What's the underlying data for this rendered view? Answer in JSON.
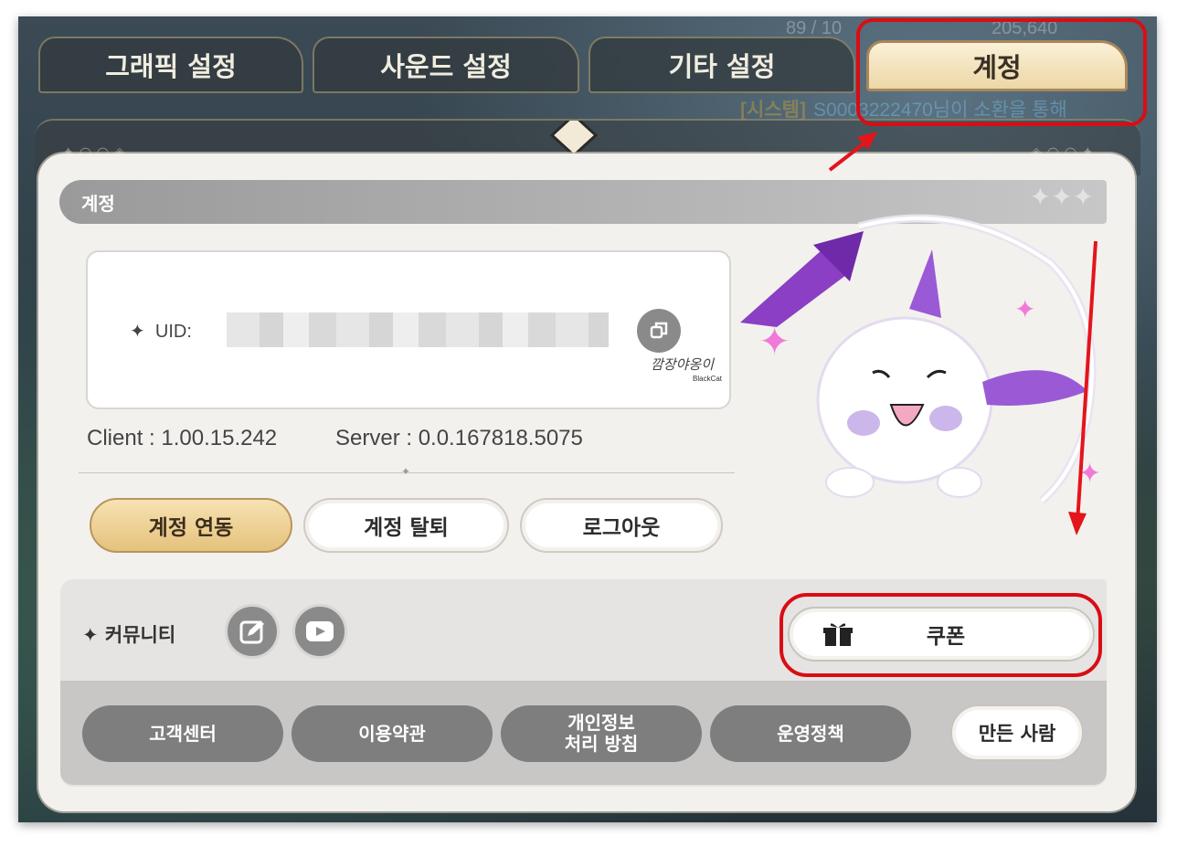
{
  "tabs": [
    {
      "label": "그래픽 설정",
      "active": false
    },
    {
      "label": "사운드 설정",
      "active": false
    },
    {
      "label": "기타 설정",
      "active": false
    },
    {
      "label": "계정",
      "active": true
    }
  ],
  "hud": {
    "keys": "89 / 10",
    "gold": "205,640",
    "system_tag": "[시스템]",
    "system_msg": "S0003222470님이 소환을 통해"
  },
  "section": {
    "title": "계정"
  },
  "uid": {
    "label": "UID:"
  },
  "watermark": {
    "text": "깜장야옹이",
    "sub": "BlackCat"
  },
  "version": {
    "client": "Client : 1.00.15.242",
    "server": "Server : 0.0.167818.5075"
  },
  "account_buttons": {
    "link": "계정 연동",
    "withdraw": "계정 탈퇴",
    "logout": "로그아웃"
  },
  "community": {
    "label": "커뮤니티",
    "coupon": "쿠폰"
  },
  "footer_links": {
    "support": "고객센터",
    "terms": "이용약관",
    "privacy_line1": "개인정보",
    "privacy_line2": "처리 방침",
    "policy": "운영정책",
    "credits": "만든 사람"
  },
  "colors": {
    "highlight": "#d90d14",
    "active_tab": "#f3e3bb",
    "gold_button": "#e5c27d",
    "panel": "#f3f1ee",
    "gray_button": "#7e7e7e"
  }
}
